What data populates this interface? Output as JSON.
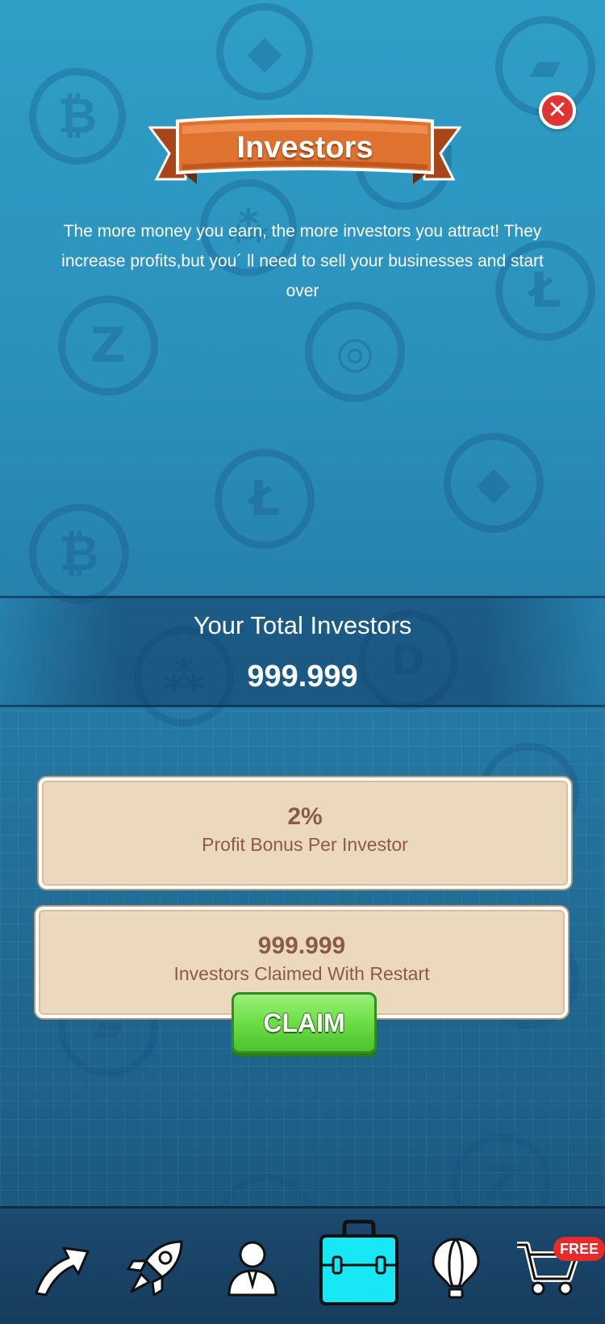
{
  "header": {
    "title": "Investors",
    "close_icon": "close-icon"
  },
  "description": "The more money you earn, the more investors you attract! They increase profits,but you´ ll need to sell your businesses and start over",
  "total": {
    "label": "Your Total Investors",
    "value": "999.999"
  },
  "cards": [
    {
      "value": "2%",
      "label": "Profit Bonus Per Investor"
    },
    {
      "value": "999.999",
      "label": "Investors Claimed With Restart"
    }
  ],
  "claim_button": {
    "label": "CLAIM"
  },
  "nav": {
    "items": [
      {
        "icon": "upgrade-arrow-icon"
      },
      {
        "icon": "rocket-icon"
      },
      {
        "icon": "manager-icon"
      },
      {
        "icon": "briefcase-icon",
        "active": true
      },
      {
        "icon": "hot-air-balloon-icon"
      },
      {
        "icon": "shop-cart-icon"
      }
    ],
    "free_badge": "FREE"
  },
  "colors": {
    "banner": "#e0722f",
    "card_bg": "#ecd8bd",
    "card_text": "#8a5a4a",
    "claim_green": "#6fe04a",
    "active_tab": "#18e8f5",
    "close_red": "#e03434",
    "free_red": "#e52b2b"
  }
}
